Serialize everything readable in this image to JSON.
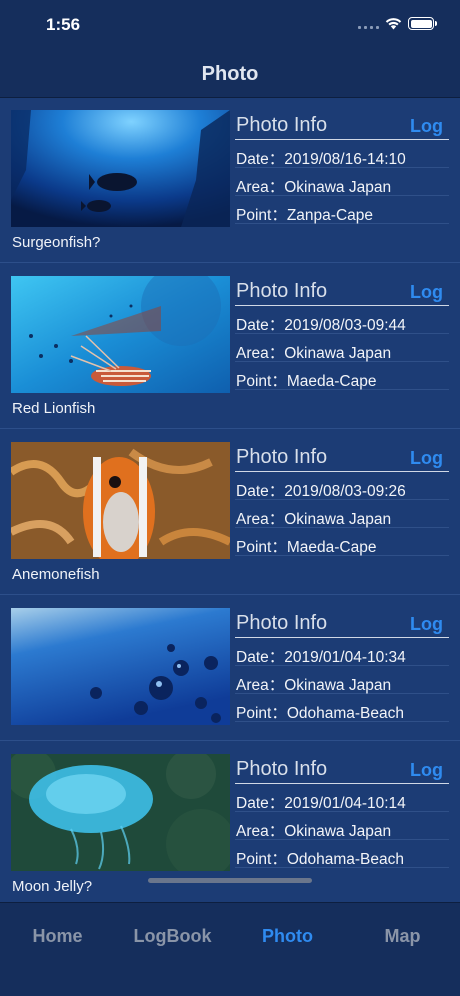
{
  "status": {
    "time": "1:56"
  },
  "nav": {
    "title": "Photo"
  },
  "photos": [
    {
      "caption": "Surgeonfish?",
      "info_title": "Photo Info",
      "log_label": "Log",
      "date": "Date：2019/08/16-14:10",
      "area": "Area：Okinawa Japan",
      "point": "Point：Zanpa-Cape"
    },
    {
      "caption": "Red Lionfish",
      "info_title": "Photo Info",
      "log_label": "Log",
      "date": "Date：2019/08/03-09:44",
      "area": "Area：Okinawa Japan",
      "point": "Point：Maeda-Cape"
    },
    {
      "caption": "Anemonefish",
      "info_title": "Photo Info",
      "log_label": "Log",
      "date": "Date：2019/08/03-09:26",
      "area": "Area：Okinawa Japan",
      "point": "Point：Maeda-Cape"
    },
    {
      "caption": "",
      "info_title": "Photo Info",
      "log_label": "Log",
      "date": "Date：2019/01/04-10:34",
      "area": "Area：Okinawa Japan",
      "point": "Point：Odohama-Beach"
    },
    {
      "caption": "Moon Jelly?",
      "info_title": "Photo Info",
      "log_label": "Log",
      "date": "Date：2019/01/04-10:14",
      "area": "Area：Okinawa Japan",
      "point": "Point：Odohama-Beach"
    }
  ],
  "tabs": [
    {
      "label": "Home"
    },
    {
      "label": "LogBook"
    },
    {
      "label": "Photo"
    },
    {
      "label": "Map"
    }
  ],
  "colors": {
    "accent": "#2f8bf0",
    "background": "#1c3c75",
    "bar": "#152e5c"
  }
}
